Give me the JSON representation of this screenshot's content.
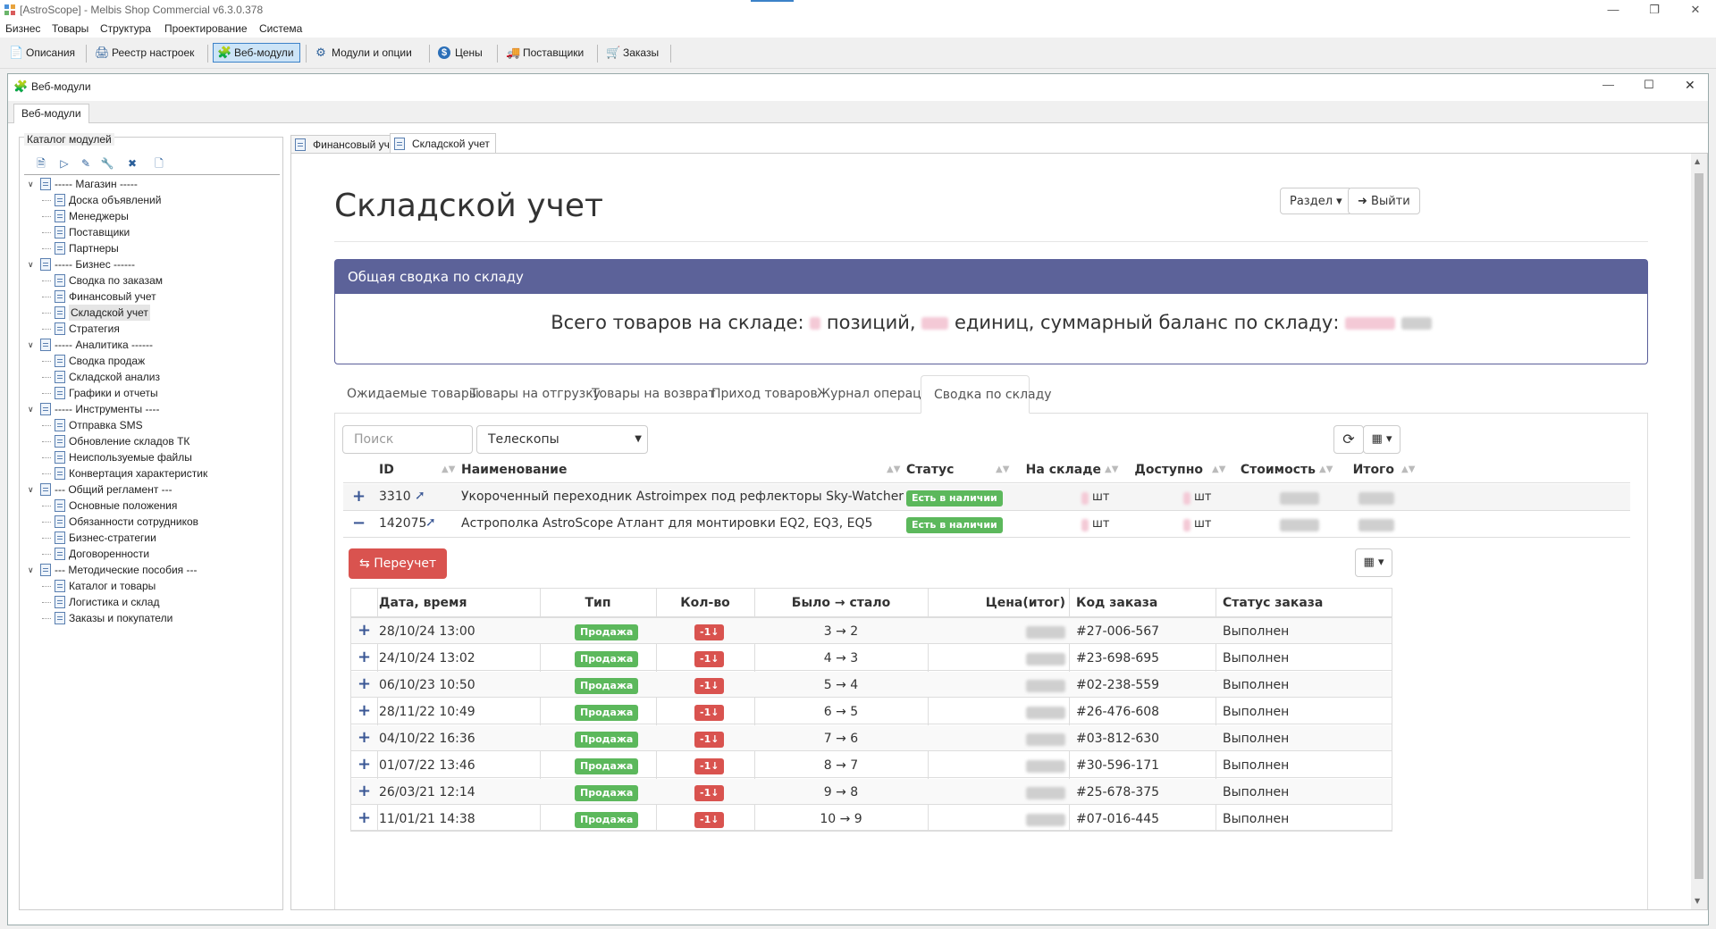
{
  "window": {
    "title": "[AstroScope] - Melbis Shop Commercial v6.3.0.378",
    "controls": [
      "minimize-icon",
      "restore-icon",
      "close-icon"
    ]
  },
  "menu": [
    "Бизнес",
    "Товары",
    "Структура",
    "Проектирование",
    "Система"
  ],
  "toolbar": [
    {
      "label": "Описания",
      "icon": "document-icon"
    },
    {
      "label": "Реестр настроек",
      "icon": "registry-icon"
    },
    {
      "label": "Веб-модули",
      "icon": "puzzle-icon",
      "active": true
    },
    {
      "label": "Модули и опции",
      "icon": "modules-icon"
    },
    {
      "label": "Цены",
      "icon": "dollar-icon"
    },
    {
      "label": "Поставщики",
      "icon": "truck-icon"
    },
    {
      "label": "Заказы",
      "icon": "cart-icon"
    }
  ],
  "mdi": {
    "title": "Веб-модули",
    "tab": "Веб-модули"
  },
  "catalog": {
    "label": "Каталог модулей",
    "tree": [
      {
        "label": "----- Магазин -----",
        "level": 0
      },
      {
        "label": "Доска объявлений",
        "level": 1
      },
      {
        "label": "Менеджеры",
        "level": 1
      },
      {
        "label": "Поставщики",
        "level": 1
      },
      {
        "label": "Партнеры",
        "level": 1
      },
      {
        "label": "----- Бизнес ------",
        "level": 0
      },
      {
        "label": "Сводка по заказам",
        "level": 1
      },
      {
        "label": "Финансовый учет",
        "level": 1
      },
      {
        "label": "Складской учет",
        "level": 1,
        "selected": true
      },
      {
        "label": "Стратегия",
        "level": 1
      },
      {
        "label": "----- Аналитика ------",
        "level": 0
      },
      {
        "label": "Сводка продаж",
        "level": 1
      },
      {
        "label": "Складской анализ",
        "level": 1
      },
      {
        "label": "Графики и отчеты",
        "level": 1
      },
      {
        "label": "----- Инструменты ----",
        "level": 0
      },
      {
        "label": "Отправка SMS",
        "level": 1
      },
      {
        "label": "Обновление складов ТК",
        "level": 1
      },
      {
        "label": "Неиспользуемые файлы",
        "level": 1
      },
      {
        "label": "Конвертация характеристик",
        "level": 1
      },
      {
        "label": "--- Общий регламент ---",
        "level": 0
      },
      {
        "label": "Основные положения",
        "level": 1
      },
      {
        "label": "Обязанности сотрудников",
        "level": 1
      },
      {
        "label": "Бизнес-стратегии",
        "level": 1
      },
      {
        "label": "Договоренности",
        "level": 1
      },
      {
        "label": "--- Методические пособия ---",
        "level": 0
      },
      {
        "label": "Каталог и товары",
        "level": 1
      },
      {
        "label": "Логистика и склад",
        "level": 1
      },
      {
        "label": "Заказы и покупатели",
        "level": 1
      }
    ]
  },
  "doc_tabs": [
    {
      "label": "Финансовый учет"
    },
    {
      "label": "Складской учет",
      "active": true
    }
  ],
  "page": {
    "title": "Складской учет",
    "section_btn": "Раздел",
    "exit_btn": "Выйти",
    "summary_head": "Общая сводка по складу",
    "summary_prefix": "Всего товаров на складе:",
    "summary_mid1": "позиций,",
    "summary_mid2": "единиц, суммарный баланс по складу:",
    "tabs": [
      "Ожидаемые товары",
      "Товары на отгрузку",
      "Товары на возврат",
      "Приход товаров",
      "Журнал операций",
      "Сводка по складу"
    ],
    "search_placeholder": "Поиск",
    "category_value": "Телескопы",
    "columns": [
      "ID",
      "Наименование",
      "Статус",
      "На складе",
      "Доступно",
      "Стоимость",
      "Итого"
    ],
    "products": [
      {
        "expander": "+",
        "id": "3310",
        "name": "Укороченный переходник Astroimpex под рефлекторы Sky-Watcher",
        "status": "Есть в наличии",
        "stock_unit": "шт",
        "avail_unit": "шт"
      },
      {
        "expander": "−",
        "id": "142075",
        "name": "Астрополка AstroScope Атлант для монтировки EQ2, EQ3, EQ5",
        "status": "Есть в наличии",
        "stock_unit": "шт",
        "avail_unit": "шт"
      }
    ],
    "recount_btn": "Переучет",
    "sub_columns": [
      "Дата, время",
      "Тип",
      "Кол-во",
      "Было → стало",
      "Цена(итог)",
      "Код заказа",
      "Статус заказа"
    ],
    "operations": [
      {
        "date": "28/10/24 13:00",
        "type": "Продажа",
        "qty": "-1↓",
        "change": "3 → 2",
        "order": "#27-006-567",
        "status": "Выполнен"
      },
      {
        "date": "24/10/24 13:02",
        "type": "Продажа",
        "qty": "-1↓",
        "change": "4 → 3",
        "order": "#23-698-695",
        "status": "Выполнен"
      },
      {
        "date": "06/10/23 10:50",
        "type": "Продажа",
        "qty": "-1↓",
        "change": "5 → 4",
        "order": "#02-238-559",
        "status": "Выполнен"
      },
      {
        "date": "28/11/22 10:49",
        "type": "Продажа",
        "qty": "-1↓",
        "change": "6 → 5",
        "order": "#26-476-608",
        "status": "Выполнен"
      },
      {
        "date": "04/10/22 16:36",
        "type": "Продажа",
        "qty": "-1↓",
        "change": "7 → 6",
        "order": "#03-812-630",
        "status": "Выполнен"
      },
      {
        "date": "01/07/22 13:46",
        "type": "Продажа",
        "qty": "-1↓",
        "change": "8 → 7",
        "order": "#30-596-171",
        "status": "Выполнен"
      },
      {
        "date": "26/03/21 12:14",
        "type": "Продажа",
        "qty": "-1↓",
        "change": "9 → 8",
        "order": "#25-678-375",
        "status": "Выполнен"
      },
      {
        "date": "11/01/21 14:38",
        "type": "Продажа",
        "qty": "-1↓",
        "change": "10 → 9",
        "order": "#07-016-445",
        "status": "Выполнен"
      }
    ]
  }
}
